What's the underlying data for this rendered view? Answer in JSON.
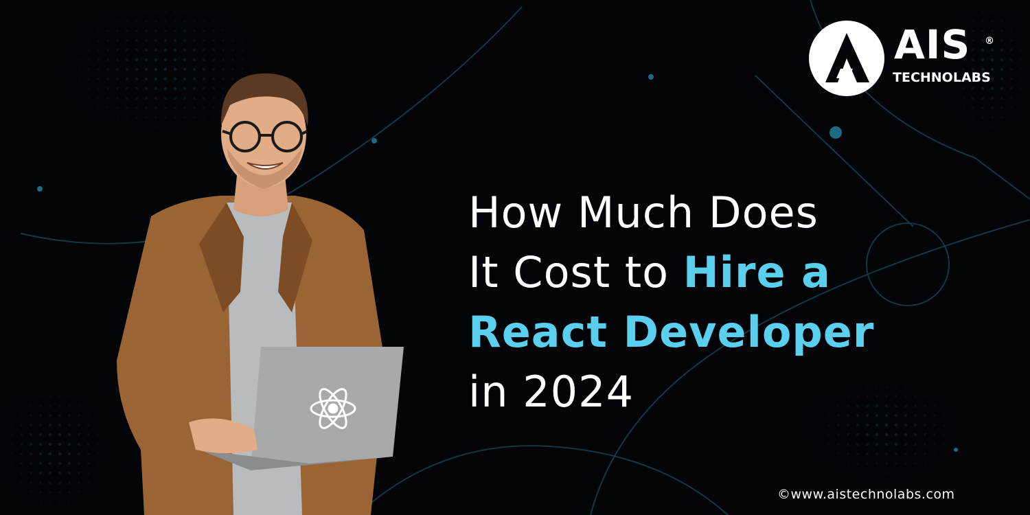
{
  "logo": {
    "wordmark": "AIS",
    "subtitle": "TECHNOLABS",
    "registered": "®"
  },
  "headline": {
    "line1": "How Much Does",
    "line2_plain": "It Cost to ",
    "line2_highlight": "Hire a",
    "line3_highlight": "React Developer",
    "line4": "in 2024"
  },
  "footer": {
    "copyright": "©www.aistechnolabs.com"
  },
  "colors": {
    "background": "#020407",
    "accent": "#5bd0ee",
    "text": "#ffffff"
  },
  "icons": [
    "react-logo-icon",
    "ais-logo-mark-icon"
  ]
}
